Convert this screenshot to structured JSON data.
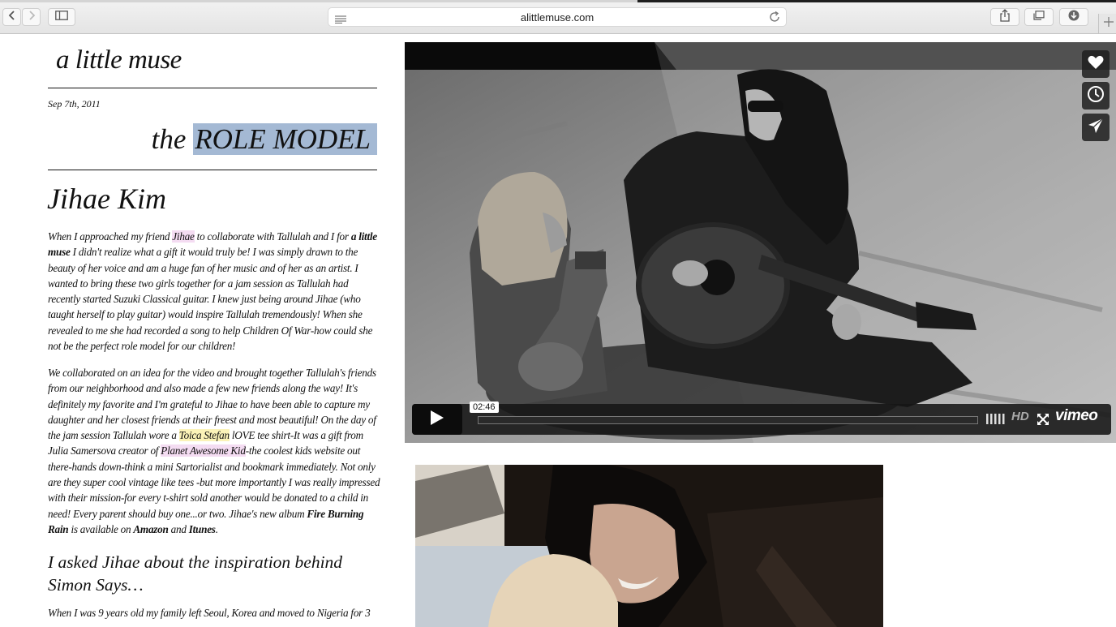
{
  "browser": {
    "url": "alittlemuse.com",
    "back_icon": "chevron-left-icon",
    "forward_icon": "chevron-right-icon",
    "sidebar_icon": "sidebar-icon",
    "reader_icon": "reader-icon",
    "reload_icon": "reload-icon",
    "share_icon": "share-icon",
    "tabs_icon": "tabs-icon",
    "downloads_icon": "download-icon",
    "new_tab_icon": "plus-icon"
  },
  "blog": {
    "title": "a little muse",
    "date": "Sep 7th, 2011",
    "post_title_prefix": "the",
    "post_title_highlight": "ROLE MODEL",
    "author": "Jihae Kim",
    "p1": {
      "t1": "When I approached my friend ",
      "l1": "Jihae",
      "t2": " to collaborate with Tallulah and I for ",
      "b1": "a little muse",
      "t3": " I didn't realize what a gift it would truly be! I was simply drawn to the beauty of her voice and am a huge fan of her music and of her as an artist.  I wanted to bring these two girls together for a jam session as Tallulah had recently started Suzuki Classical guitar.  I knew just being around Jihae (who taught herself to play guitar) would inspire Tallulah tremendously!  When she revealed to me she had recorded a song to help Children Of War-how could she not be the perfect role model for our children!"
    },
    "p2": {
      "t1": "We collaborated on an idea for the video and brought together Tallulah's friends from our neighborhood and also made a few new friends along the way!  It's definitely my favorite and I'm grateful to Jihae to have been able to capture my daughter and her closest friends at their freest and most beautiful!  On the day of the jam session Tallulah wore a ",
      "l1": "Toica Stefan",
      "t2": " lOVE tee shirt-It was a gift from Julia Samersova creator of ",
      "l2": "Planet Awesome Kid",
      "t3": "-the coolest kids website out there-hands down-think a mini Sartorialist and bookmark immediately. Not only are they super cool vintage like tees -but more importantly I was really impressed with their mission-for every t-shirt sold another would be donated to a child in need! Every parent should buy one...or two.  Jihae's new album ",
      "b1": "Fire Burning Rain",
      "t4": " is available on ",
      "b2": "Amazon",
      "t5": " and ",
      "b3": "Itunes",
      "t6": "."
    },
    "subheading": "I asked Jihae about the inspiration behind Simon Says…",
    "p3": "When I was 9 years old my family left Seoul, Korea and moved to Nigeria for 3"
  },
  "video": {
    "timecode": "02:46",
    "hd_label": "HD",
    "brand": "vimeo",
    "like_icon": "heart-icon",
    "watch_later_icon": "clock-icon",
    "share_icon": "paper-plane-icon",
    "play_icon": "play-icon",
    "volume_icon": "volume-bars-icon",
    "fullscreen_icon": "fullscreen-icon"
  }
}
